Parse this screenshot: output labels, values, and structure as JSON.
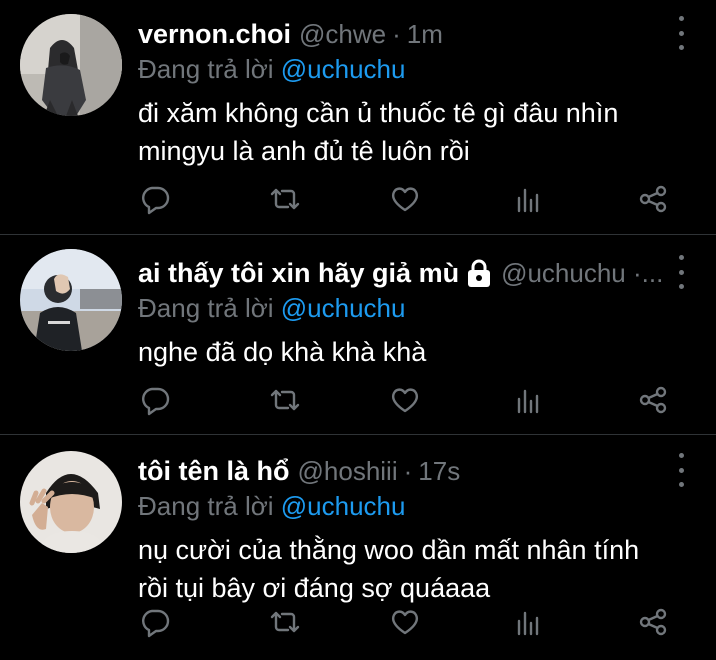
{
  "tweets": [
    {
      "name": "vernon.choi",
      "handle": "@chwe",
      "separator": "·",
      "time": "1m",
      "locked": false,
      "replying_prefix": "Đang trả lời ",
      "replying_to": "@uchuchu",
      "text_lines": [
        "đi xăm không cần ủ thuốc tê gì đâu nhìn",
        "mingyu là anh đủ tê luôn rồi"
      ]
    },
    {
      "name": "ai thấy tôi xin hãy giả mù",
      "handle": "@uchuchu ·...",
      "separator": "",
      "time": "",
      "locked": true,
      "replying_prefix": "Đang trả lời ",
      "replying_to": "@uchuchu",
      "text_lines": [
        "nghe đã dọ khà khà khà"
      ]
    },
    {
      "name": "tôi tên là hổ",
      "handle": "@hoshiii",
      "separator": "·",
      "time": "17s",
      "locked": false,
      "replying_prefix": "Đang trả lời ",
      "replying_to": "@uchuchu",
      "text_lines": [
        "nụ cười của thằng woo dần mất nhân tính",
        "rồi tụi bây ơi đáng sợ quáaaa"
      ]
    }
  ],
  "colors": {
    "background": "#000000",
    "primary_text": "#ffffff",
    "secondary_text": "#71767b",
    "mention": "#1d9bf0",
    "divider": "#2f3336"
  },
  "icons": {
    "reply": "reply-icon",
    "retweet": "retweet-icon",
    "like": "heart-icon",
    "stats": "stats-icon",
    "share": "share-icon",
    "more": "more-vertical-icon",
    "lock": "lock-icon"
  }
}
